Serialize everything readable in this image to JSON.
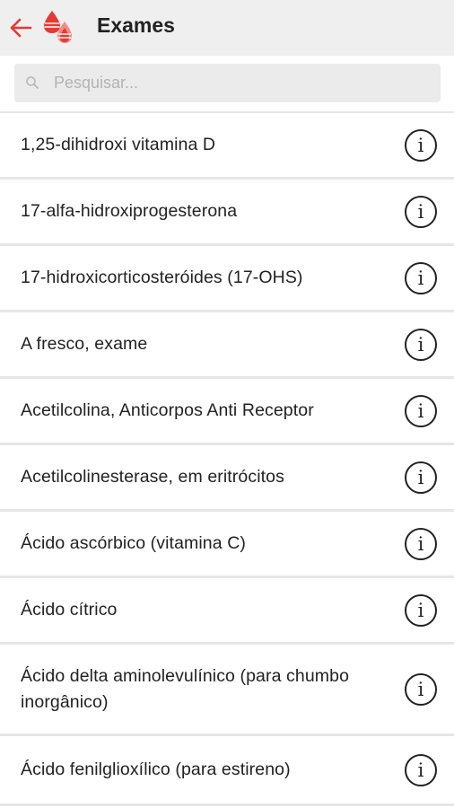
{
  "app": {
    "title": "Exames",
    "brand_color": "#e53935"
  },
  "icons": {
    "back": "arrow-left-icon",
    "logo": "blood-drops-logo",
    "search": "search-icon",
    "info": "info-circle-icon"
  },
  "search": {
    "placeholder": "Pesquisar...",
    "value": ""
  },
  "items": [
    {
      "label": "1,25-dihidroxi vitamina D",
      "info": "i"
    },
    {
      "label": "17-alfa-hidroxiprogesterona",
      "info": "i"
    },
    {
      "label": "17-hidroxicorticosteróides (17-OHS)",
      "info": "i"
    },
    {
      "label": "A fresco, exame",
      "info": "i"
    },
    {
      "label": "Acetilcolina, Anticorpos Anti Receptor",
      "info": "i"
    },
    {
      "label": "Acetilcolinesterase, em eritrócitos",
      "info": "i"
    },
    {
      "label": "Ácido ascórbico (vitamina C)",
      "info": "i"
    },
    {
      "label": "Ácido cítrico",
      "info": "i"
    },
    {
      "label": "Ácido delta aminolevulínico (para chumbo inorgânico)",
      "info": "i"
    },
    {
      "label": "Ácido fenilglioxílico (para estireno)",
      "info": "i"
    }
  ]
}
